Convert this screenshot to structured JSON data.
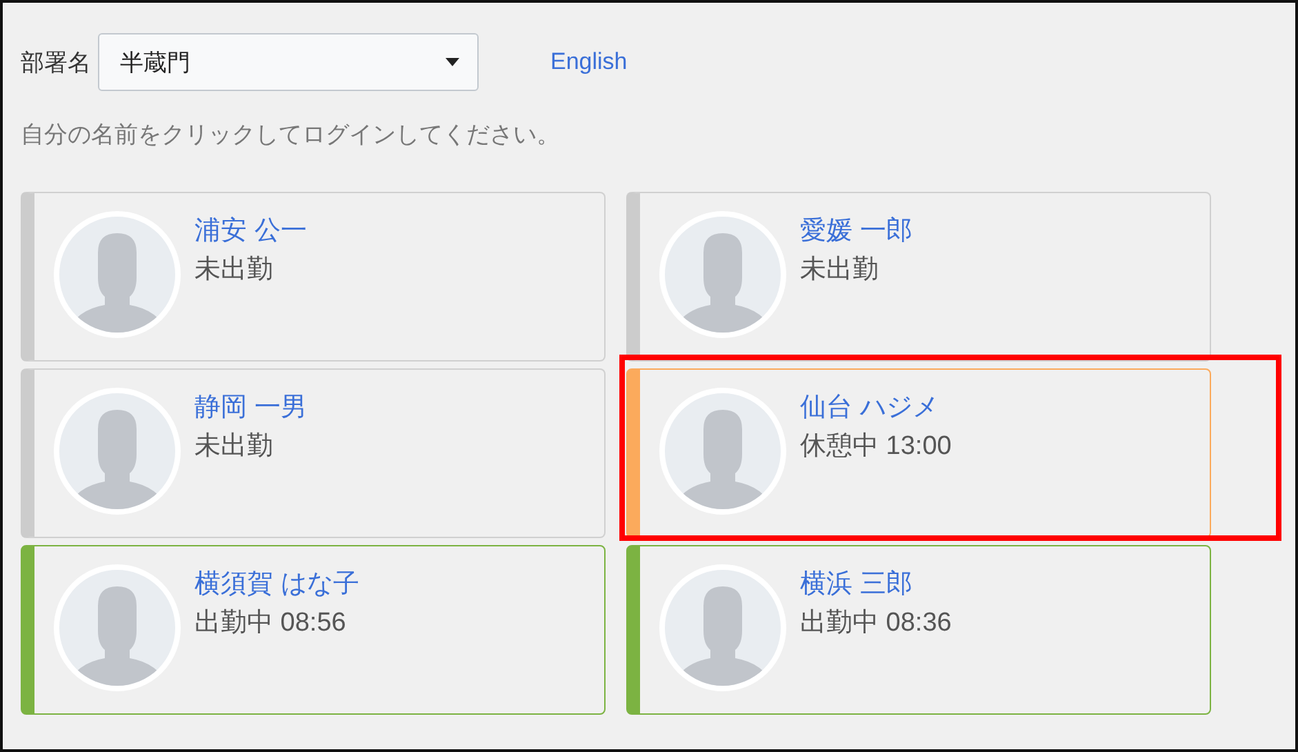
{
  "department": {
    "label": "部署名",
    "value": "半蔵門"
  },
  "language_link": "English",
  "instruction": "自分の名前をクリックしてログインしてください。",
  "employees": [
    {
      "name": "浦安 公一",
      "status": "未出勤",
      "color": "#cccccc",
      "highlighted": false
    },
    {
      "name": "愛媛 一郎",
      "status": "未出勤",
      "color": "#cccccc",
      "highlighted": false
    },
    {
      "name": "静岡 一男",
      "status": "未出勤",
      "color": "#cccccc",
      "highlighted": false
    },
    {
      "name": "仙台 ハジメ",
      "status": "休憩中 13:00",
      "color": "#fbaa5c",
      "highlighted": true
    },
    {
      "name": "横須賀 はな子",
      "status": "出勤中 08:56",
      "color": "#7cb342",
      "highlighted": false
    },
    {
      "name": "横浜 三郎",
      "status": "出勤中 08:36",
      "color": "#7cb342",
      "highlighted": false
    }
  ]
}
